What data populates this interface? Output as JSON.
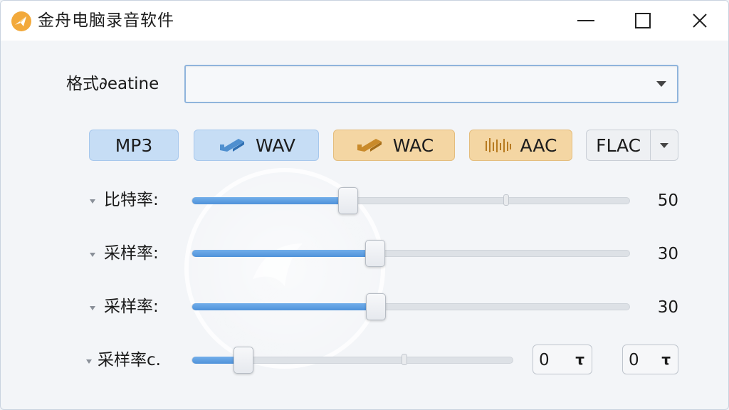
{
  "window": {
    "title": "金舟电脑录音软件",
    "controls": {
      "minimize": "minimize-icon",
      "maximize": "maximize-icon",
      "close": "close-icon"
    }
  },
  "format": {
    "label": "格式∂eatine",
    "select_value": ""
  },
  "format_buttons": [
    {
      "label": "MP3",
      "icon": "",
      "style": "blue"
    },
    {
      "label": "WAV",
      "icon": "pencil-icon",
      "style": "blue"
    },
    {
      "label": "WAC",
      "icon": "pencil-icon",
      "style": "orange"
    },
    {
      "label": "AAC",
      "icon": "waveform-icon",
      "style": "orange"
    },
    {
      "label": "FLAC",
      "icon": "chevron-down-icon",
      "style": "gray"
    }
  ],
  "sliders": [
    {
      "label": "比特率:",
      "value": "50",
      "fraction": 0.357
    },
    {
      "label": "采样率:",
      "value": "30",
      "fraction": 0.418
    },
    {
      "label": "采样率:",
      "value": "30",
      "fraction": 0.42
    }
  ],
  "last_row": {
    "label": "采样率c.",
    "fraction": 0.16,
    "spin1": {
      "value": "0",
      "arrow": "τ"
    },
    "spin2": {
      "value": "0",
      "arrow": "τ"
    }
  },
  "colors": {
    "accent_blue": "#4f92da",
    "button_blue": "#c6ddf5",
    "button_orange": "#f4d6a3",
    "app_icon_orange": "#f0a030"
  }
}
